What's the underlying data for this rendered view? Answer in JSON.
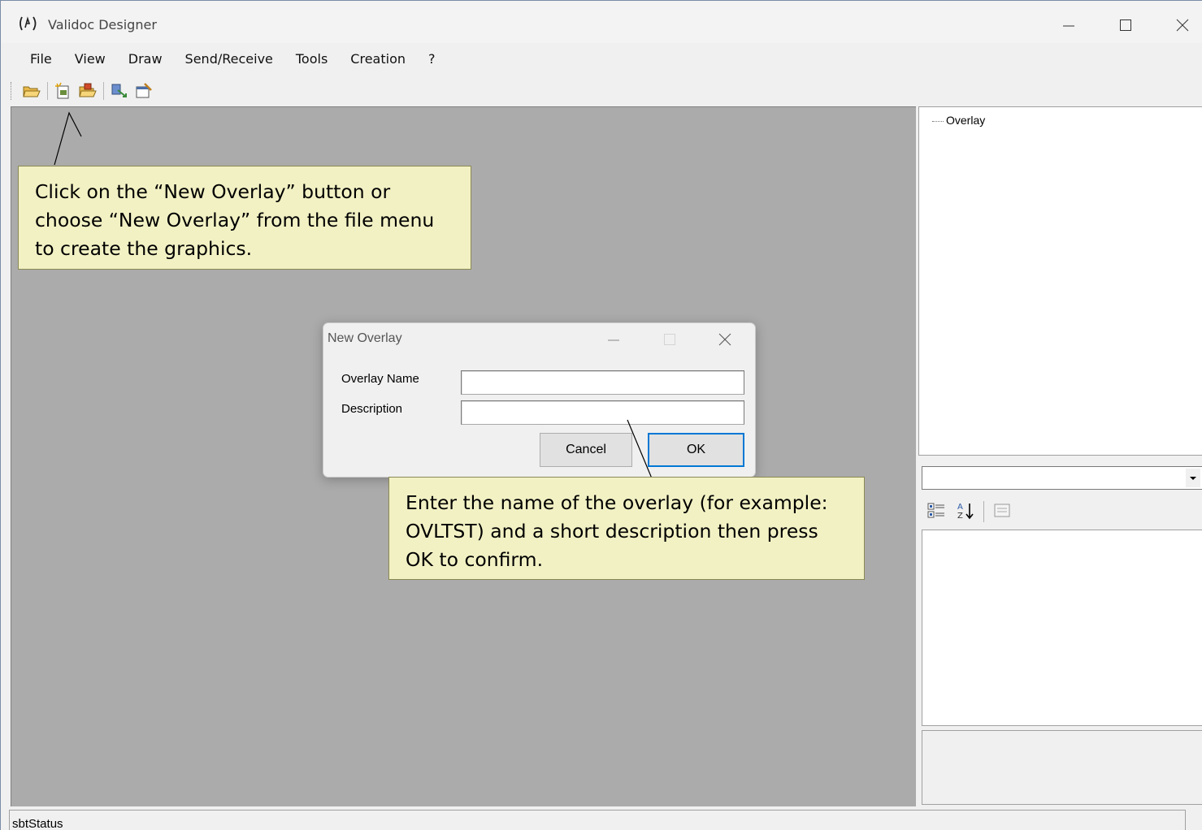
{
  "window": {
    "title": "Validoc Designer"
  },
  "menu": {
    "items": [
      "File",
      "View",
      "Draw",
      "Send/Receive",
      "Tools",
      "Creation",
      "?"
    ]
  },
  "toolbar": {
    "icons": [
      "open-folder-icon",
      "new-overlay-icon",
      "open-overlay-icon",
      "send-receive-icon",
      "properties-icon"
    ]
  },
  "tree": {
    "root_label": "Overlay"
  },
  "property_toolbar": {
    "icons": [
      "categorized-icon",
      "alphabetical-sort-icon",
      "property-pages-icon"
    ]
  },
  "status": {
    "text": "sbtStatus"
  },
  "dialog": {
    "title": "New Overlay",
    "fields": {
      "name_label": "Overlay Name",
      "name_value": "",
      "description_label": "Description",
      "description_value": ""
    },
    "buttons": {
      "cancel": "Cancel",
      "ok": "OK"
    }
  },
  "callouts": {
    "top": "Click on the “New Overlay” button or choose “New Overlay” from the file menu to create the graphics.",
    "bottom": "Enter the name of the overlay (for example: OVLTST) and a short description then press OK to confirm."
  },
  "colors": {
    "workspace": "#ababab",
    "callout_bg": "#f2f1c4",
    "callout_border": "#8b8a54",
    "accent": "#0078d4"
  }
}
